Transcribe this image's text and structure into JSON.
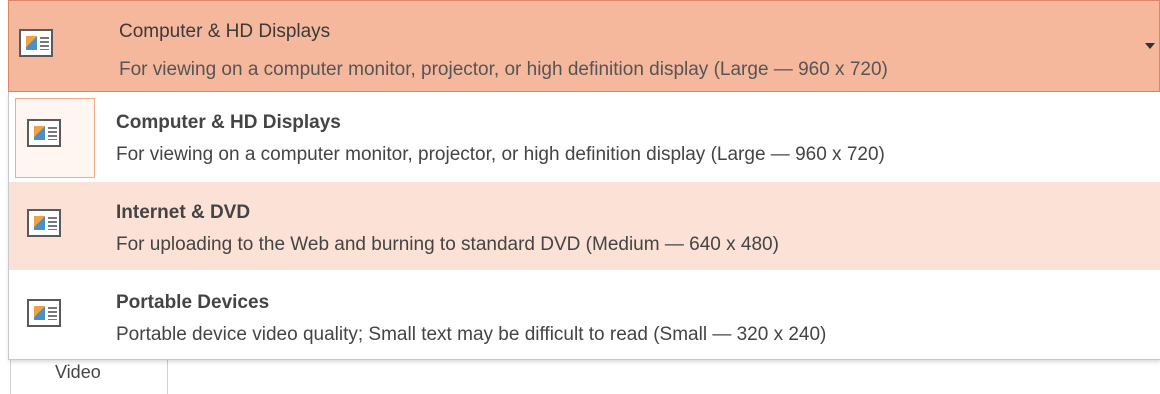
{
  "combo": {
    "title": "Computer & HD Displays",
    "description": "For viewing on a computer monitor, projector, or high definition display  (Large — 960 x 720)",
    "icon": "slide-size-icon"
  },
  "options": [
    {
      "title": "Computer & HD Displays",
      "description": "For viewing on a computer monitor, projector, or high definition display  (Large — 960 x 720)",
      "icon": "slide-size-icon"
    },
    {
      "title": "Internet & DVD",
      "description": "For uploading to the Web and burning to standard DVD  (Medium — 640 x 480)",
      "icon": "slide-size-icon"
    },
    {
      "title": "Portable Devices",
      "description": "Portable device video quality; Small text may be difficult to read  (Small — 320 x 240)",
      "icon": "slide-size-icon"
    }
  ],
  "background_tab": {
    "label": "Video"
  },
  "colors": {
    "selected_fill": "#f5b89d",
    "selected_border": "#e0846a",
    "hover_fill": "#fbe1d6",
    "text": "#444444"
  }
}
